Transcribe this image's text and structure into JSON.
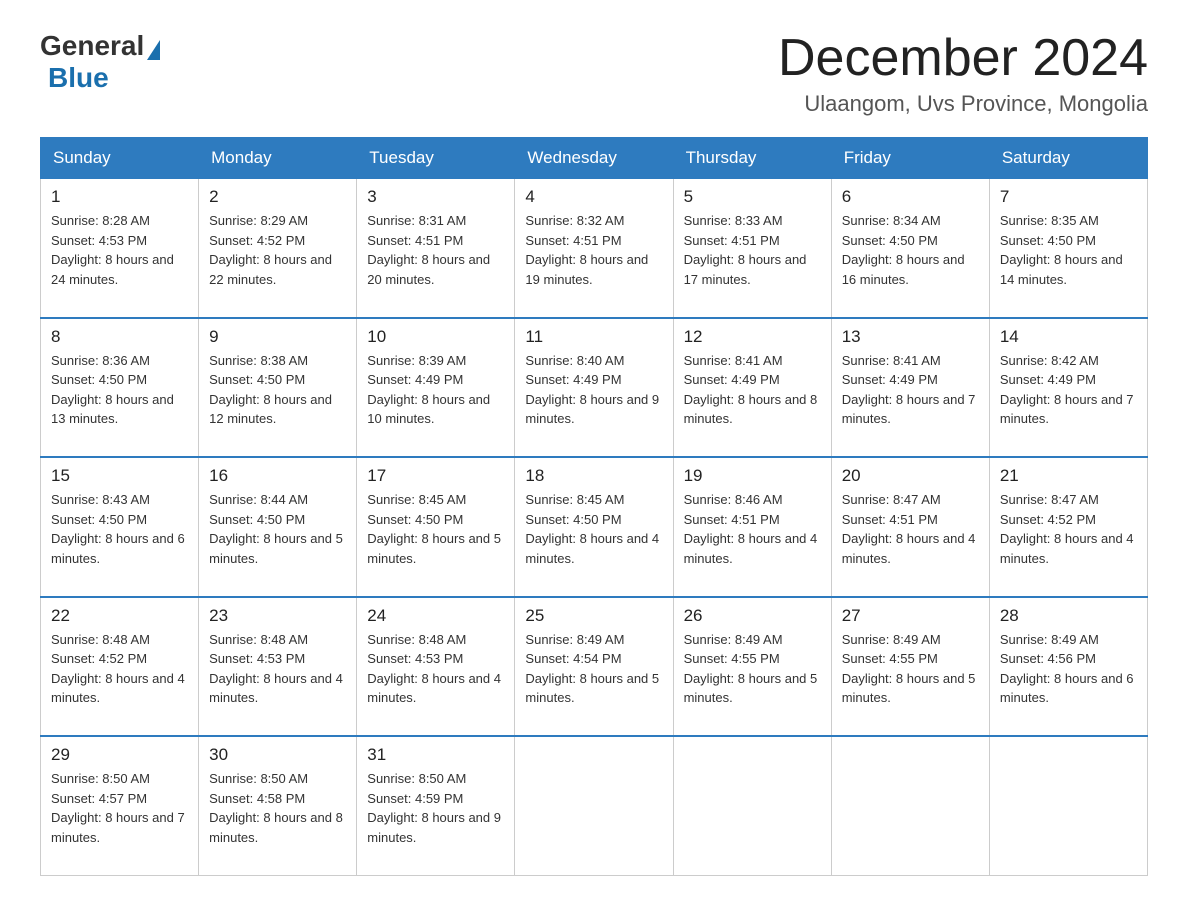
{
  "header": {
    "logo_general": "General",
    "logo_blue": "Blue",
    "month_title": "December 2024",
    "location": "Ulaangom, Uvs Province, Mongolia"
  },
  "weekdays": [
    "Sunday",
    "Monday",
    "Tuesday",
    "Wednesday",
    "Thursday",
    "Friday",
    "Saturday"
  ],
  "weeks": [
    [
      {
        "day": "1",
        "sunrise": "8:28 AM",
        "sunset": "4:53 PM",
        "daylight": "8 hours and 24 minutes."
      },
      {
        "day": "2",
        "sunrise": "8:29 AM",
        "sunset": "4:52 PM",
        "daylight": "8 hours and 22 minutes."
      },
      {
        "day": "3",
        "sunrise": "8:31 AM",
        "sunset": "4:51 PM",
        "daylight": "8 hours and 20 minutes."
      },
      {
        "day": "4",
        "sunrise": "8:32 AM",
        "sunset": "4:51 PM",
        "daylight": "8 hours and 19 minutes."
      },
      {
        "day": "5",
        "sunrise": "8:33 AM",
        "sunset": "4:51 PM",
        "daylight": "8 hours and 17 minutes."
      },
      {
        "day": "6",
        "sunrise": "8:34 AM",
        "sunset": "4:50 PM",
        "daylight": "8 hours and 16 minutes."
      },
      {
        "day": "7",
        "sunrise": "8:35 AM",
        "sunset": "4:50 PM",
        "daylight": "8 hours and 14 minutes."
      }
    ],
    [
      {
        "day": "8",
        "sunrise": "8:36 AM",
        "sunset": "4:50 PM",
        "daylight": "8 hours and 13 minutes."
      },
      {
        "day": "9",
        "sunrise": "8:38 AM",
        "sunset": "4:50 PM",
        "daylight": "8 hours and 12 minutes."
      },
      {
        "day": "10",
        "sunrise": "8:39 AM",
        "sunset": "4:49 PM",
        "daylight": "8 hours and 10 minutes."
      },
      {
        "day": "11",
        "sunrise": "8:40 AM",
        "sunset": "4:49 PM",
        "daylight": "8 hours and 9 minutes."
      },
      {
        "day": "12",
        "sunrise": "8:41 AM",
        "sunset": "4:49 PM",
        "daylight": "8 hours and 8 minutes."
      },
      {
        "day": "13",
        "sunrise": "8:41 AM",
        "sunset": "4:49 PM",
        "daylight": "8 hours and 7 minutes."
      },
      {
        "day": "14",
        "sunrise": "8:42 AM",
        "sunset": "4:49 PM",
        "daylight": "8 hours and 7 minutes."
      }
    ],
    [
      {
        "day": "15",
        "sunrise": "8:43 AM",
        "sunset": "4:50 PM",
        "daylight": "8 hours and 6 minutes."
      },
      {
        "day": "16",
        "sunrise": "8:44 AM",
        "sunset": "4:50 PM",
        "daylight": "8 hours and 5 minutes."
      },
      {
        "day": "17",
        "sunrise": "8:45 AM",
        "sunset": "4:50 PM",
        "daylight": "8 hours and 5 minutes."
      },
      {
        "day": "18",
        "sunrise": "8:45 AM",
        "sunset": "4:50 PM",
        "daylight": "8 hours and 4 minutes."
      },
      {
        "day": "19",
        "sunrise": "8:46 AM",
        "sunset": "4:51 PM",
        "daylight": "8 hours and 4 minutes."
      },
      {
        "day": "20",
        "sunrise": "8:47 AM",
        "sunset": "4:51 PM",
        "daylight": "8 hours and 4 minutes."
      },
      {
        "day": "21",
        "sunrise": "8:47 AM",
        "sunset": "4:52 PM",
        "daylight": "8 hours and 4 minutes."
      }
    ],
    [
      {
        "day": "22",
        "sunrise": "8:48 AM",
        "sunset": "4:52 PM",
        "daylight": "8 hours and 4 minutes."
      },
      {
        "day": "23",
        "sunrise": "8:48 AM",
        "sunset": "4:53 PM",
        "daylight": "8 hours and 4 minutes."
      },
      {
        "day": "24",
        "sunrise": "8:48 AM",
        "sunset": "4:53 PM",
        "daylight": "8 hours and 4 minutes."
      },
      {
        "day": "25",
        "sunrise": "8:49 AM",
        "sunset": "4:54 PM",
        "daylight": "8 hours and 5 minutes."
      },
      {
        "day": "26",
        "sunrise": "8:49 AM",
        "sunset": "4:55 PM",
        "daylight": "8 hours and 5 minutes."
      },
      {
        "day": "27",
        "sunrise": "8:49 AM",
        "sunset": "4:55 PM",
        "daylight": "8 hours and 5 minutes."
      },
      {
        "day": "28",
        "sunrise": "8:49 AM",
        "sunset": "4:56 PM",
        "daylight": "8 hours and 6 minutes."
      }
    ],
    [
      {
        "day": "29",
        "sunrise": "8:50 AM",
        "sunset": "4:57 PM",
        "daylight": "8 hours and 7 minutes."
      },
      {
        "day": "30",
        "sunrise": "8:50 AM",
        "sunset": "4:58 PM",
        "daylight": "8 hours and 8 minutes."
      },
      {
        "day": "31",
        "sunrise": "8:50 AM",
        "sunset": "4:59 PM",
        "daylight": "8 hours and 9 minutes."
      },
      null,
      null,
      null,
      null
    ]
  ]
}
